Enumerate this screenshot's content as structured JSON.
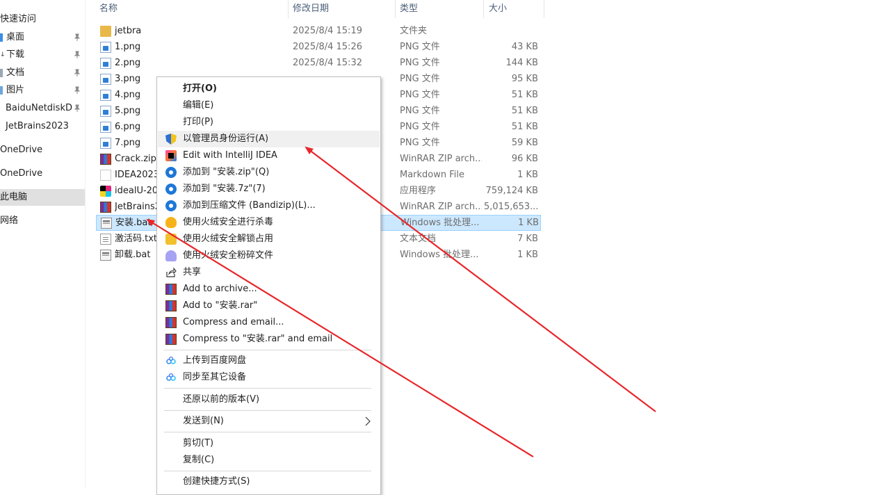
{
  "nav": {
    "quick_access": "快速访问",
    "items": [
      {
        "label": "桌面",
        "pinned": true
      },
      {
        "label": "下载",
        "pinned": true
      },
      {
        "label": "文档",
        "pinned": true
      },
      {
        "label": "图片",
        "pinned": true
      },
      {
        "label": "BaiduNetdiskDo",
        "pinned": true
      },
      {
        "label": "JetBrains2023",
        "pinned": false
      }
    ],
    "onedrive_1": "OneDrive",
    "onedrive_2": "OneDrive",
    "this_pc": "此电脑",
    "network": "网络"
  },
  "columns": {
    "name": "名称",
    "date": "修改日期",
    "type": "类型",
    "size": "大小"
  },
  "files": [
    {
      "name": "jetbra",
      "date": "2025/8/4 15:19",
      "type": "文件夹",
      "size": "",
      "icon": "folder-icon"
    },
    {
      "name": "1.png",
      "date": "2025/8/4 15:26",
      "type": "PNG 文件",
      "size": "43 KB",
      "icon": "png-file-icon"
    },
    {
      "name": "2.png",
      "date": "2025/8/4 15:32",
      "type": "PNG 文件",
      "size": "144 KB",
      "icon": "png-file-icon"
    },
    {
      "name": "3.png",
      "date": "",
      "type": "PNG 文件",
      "size": "95 KB",
      "icon": "png-file-icon"
    },
    {
      "name": "4.png",
      "date": "",
      "type": "PNG 文件",
      "size": "51 KB",
      "icon": "png-file-icon"
    },
    {
      "name": "5.png",
      "date": "",
      "type": "PNG 文件",
      "size": "51 KB",
      "icon": "png-file-icon"
    },
    {
      "name": "6.png",
      "date": "",
      "type": "PNG 文件",
      "size": "51 KB",
      "icon": "png-file-icon"
    },
    {
      "name": "7.png",
      "date": "",
      "type": "PNG 文件",
      "size": "59 KB",
      "icon": "png-file-icon"
    },
    {
      "name": "Crack.zip",
      "date": "",
      "type": "WinRAR ZIP arch...",
      "size": "96 KB",
      "icon": "winrar-zip-icon"
    },
    {
      "name": "IDEA2023",
      "date": "",
      "type": "Markdown File",
      "size": "1 KB",
      "icon": "markdown-file-icon"
    },
    {
      "name": "idealU-20",
      "date": "",
      "type": "应用程序",
      "size": "759,124 KB",
      "icon": "application-icon"
    },
    {
      "name": "JetBrains2",
      "date": "",
      "type": "WinRAR ZIP arch...",
      "size": "5,015,653...",
      "icon": "winrar-zip-icon"
    },
    {
      "name": "安装.bat",
      "date": "",
      "type": "Windows 批处理...",
      "size": "1 KB",
      "icon": "batch-file-icon",
      "selected": true
    },
    {
      "name": "激活码.txt",
      "date": "",
      "type": "文本文档",
      "size": "7 KB",
      "icon": "text-file-icon"
    },
    {
      "name": "卸载.bat",
      "date": "",
      "type": "Windows 批处理...",
      "size": "1 KB",
      "icon": "batch-file-icon"
    }
  ],
  "context_menu": {
    "open": "打开(O)",
    "edit": "编辑(E)",
    "print": "打印(P)",
    "run_as_admin": "以管理员身份运行(A)",
    "edit_intellij": "Edit with IntelliJ IDEA",
    "add_zip": "添加到 \"安装.zip\"(Q)",
    "add_7z": "添加到 \"安装.7z\"(7)",
    "add_bandizip": "添加到压缩文件 (Bandizip)(L)...",
    "huorong_scan": "使用火绒安全进行杀毒",
    "huorong_unlock": "使用火绒安全解锁占用",
    "huorong_shred": "使用火绒安全粉碎文件",
    "share": "共享",
    "add_archive": "Add to archive...",
    "add_rar": "Add to \"安装.rar\"",
    "compress_email": "Compress and email...",
    "compress_rar_email": "Compress to \"安装.rar\" and email",
    "upload_baidu": "上传到百度网盘",
    "sync_devices": "同步至其它设备",
    "restore_versions": "还原以前的版本(V)",
    "send_to": "发送到(N)",
    "cut": "剪切(T)",
    "copy": "复制(C)",
    "create_shortcut": "创建快捷方式(S)"
  },
  "colors": {
    "selection": "#cce8ff",
    "annotation_arrow": "#e8262a"
  }
}
